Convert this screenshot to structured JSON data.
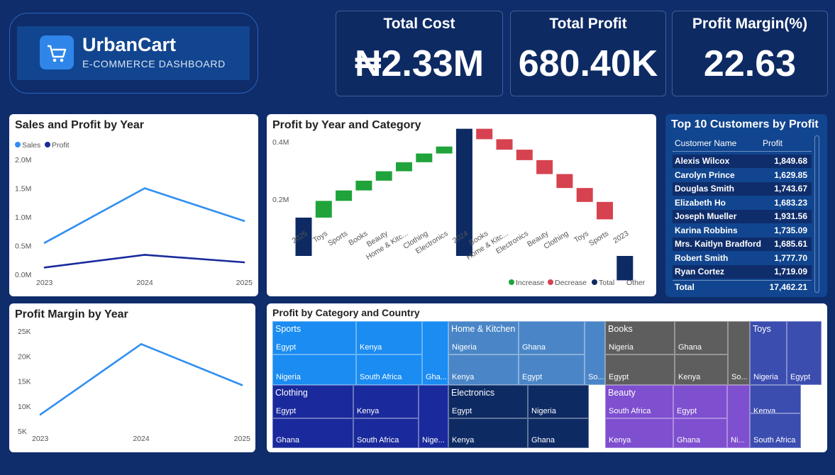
{
  "brand": {
    "name": "UrbanCart",
    "subtitle": "E-COMMERCE DASHBOARD"
  },
  "kpis": [
    {
      "title": "Total Cost",
      "value": "₦2.33M"
    },
    {
      "title": "Total Profit",
      "value": "680.40K"
    },
    {
      "title": "Profit Margin(%)",
      "value": "22.63"
    }
  ],
  "chart_data": [
    {
      "type": "line",
      "title": "Sales and Profit by Year",
      "categories": [
        "2023",
        "2024",
        "2025"
      ],
      "series": [
        {
          "name": "Sales",
          "color": "#2f8ff0",
          "values": [
            550000,
            1500000,
            930000
          ]
        },
        {
          "name": "Profit",
          "color": "#1a2a9c",
          "values": [
            120000,
            340000,
            210000
          ]
        }
      ],
      "yticks": [
        "0.0M",
        "0.5M",
        "1.0M",
        "1.5M",
        "2.0M"
      ],
      "ylim": [
        0,
        2000000
      ]
    },
    {
      "type": "waterfall",
      "title": "Profit by Year and Category",
      "yticks": [
        "0.2M",
        "0.4M"
      ],
      "categories": [
        "2025",
        "Toys",
        "Sports",
        "Books",
        "Beauty",
        "Home & Kitc...",
        "Clothing",
        "Electronics",
        "2024",
        "Books",
        "Home & Kitc...",
        "Electronics",
        "Beauty",
        "Clothing",
        "Toys",
        "Sports",
        "2023"
      ],
      "kinds": [
        "total",
        "increase",
        "increase",
        "increase",
        "increase",
        "increase",
        "increase",
        "increase",
        "total",
        "decrease",
        "decrease",
        "decrease",
        "decrease",
        "decrease",
        "decrease",
        "decrease",
        "total"
      ],
      "values": [
        210000,
        48000,
        30000,
        28000,
        27000,
        26000,
        25000,
        20000,
        465000,
        30000,
        30000,
        30000,
        40000,
        40000,
        40000,
        50000,
        30000
      ],
      "legend": [
        "Increase",
        "Decrease",
        "Total",
        "Other"
      ],
      "colors": {
        "increase": "#1fa33a",
        "decrease": "#d6424f",
        "total": "#0d2a63"
      }
    },
    {
      "type": "line",
      "title": "Profit Margin by Year",
      "categories": [
        "2023",
        "2024",
        "2025"
      ],
      "series": [
        {
          "color": "#2f8ff0",
          "values": [
            8300,
            22400,
            14200
          ]
        }
      ],
      "yticks": [
        "5K",
        "10K",
        "15K",
        "20K",
        "25K"
      ],
      "ylim": [
        5000,
        25000
      ]
    },
    {
      "type": "treemap",
      "title": "Profit by Category and Country",
      "groups": [
        {
          "name": "Sports",
          "countries": [
            "Egypt",
            "Kenya",
            "Nigeria",
            "South Africa",
            "Gha..."
          ]
        },
        {
          "name": "Home & Kitchen",
          "countries": [
            "Nigeria",
            "Ghana",
            "Kenya",
            "Egypt",
            "So..."
          ]
        },
        {
          "name": "Books",
          "countries": [
            "Nigeria",
            "Ghana",
            "Egypt",
            "Kenya",
            "So..."
          ]
        },
        {
          "name": "Toys",
          "countries": [
            "Nigeria",
            "Egypt",
            "Kenya",
            "South Africa"
          ]
        },
        {
          "name": "Clothing",
          "countries": [
            "Egypt",
            "Kenya",
            "Ghana",
            "South Africa",
            "Nige..."
          ]
        },
        {
          "name": "Electronics",
          "countries": [
            "Egypt",
            "Nigeria",
            "Kenya",
            "Ghana"
          ]
        },
        {
          "name": "Beauty",
          "countries": [
            "South Africa",
            "Egypt",
            "Kenya",
            "Ghana",
            "Ni..."
          ]
        }
      ]
    }
  ],
  "top10": {
    "title": "Top 10 Customers by Profit",
    "col1": "Customer Name",
    "col2": "Profit",
    "rows": [
      [
        "Alexis Wilcox",
        "1,849.68"
      ],
      [
        "Carolyn Prince",
        "1,629.85"
      ],
      [
        "Douglas Smith",
        "1,743.67"
      ],
      [
        "Elizabeth Ho",
        "1,683.23"
      ],
      [
        "Joseph Mueller",
        "1,931.56"
      ],
      [
        "Karina Robbins",
        "1,735.09"
      ],
      [
        "Mrs. Kaitlyn Bradford",
        "1,685.61"
      ],
      [
        "Robert Smith",
        "1,777.70"
      ],
      [
        "Ryan Cortez",
        "1,719.09"
      ]
    ],
    "total_label": "Total",
    "total_value": "17,462.21"
  }
}
